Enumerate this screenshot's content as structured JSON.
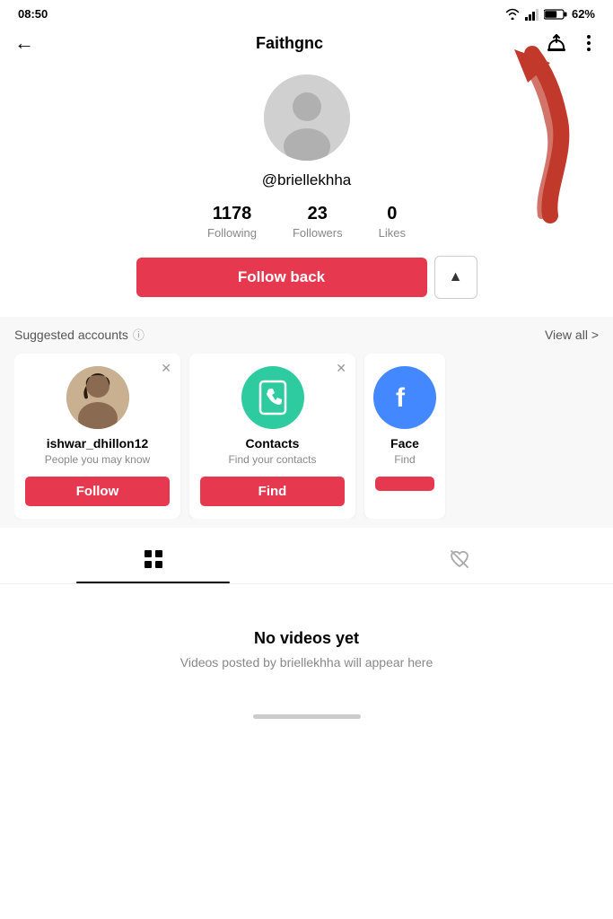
{
  "statusBar": {
    "time": "08:50",
    "battery": "62%"
  },
  "header": {
    "title": "Faithgnc",
    "backLabel": "←",
    "notifyIcon": "notify-icon",
    "moreIcon": "more-icon"
  },
  "profile": {
    "username": "@briellekhha",
    "stats": [
      {
        "value": "1178",
        "label": "Following"
      },
      {
        "value": "23",
        "label": "Followers"
      },
      {
        "value": "0",
        "label": "Likes"
      }
    ],
    "followBackLabel": "Follow back",
    "arrowUpLabel": "▲"
  },
  "suggested": {
    "title": "Suggested accounts",
    "infoIcon": "ⓘ",
    "viewAll": "View all >",
    "accounts": [
      {
        "id": "ishwar_dhillon12",
        "name": "ishwar_dhillon12",
        "desc": "People you may know",
        "btnLabel": "Follow",
        "avatarType": "person"
      },
      {
        "id": "contacts",
        "name": "Contacts",
        "desc": "Find your contacts",
        "btnLabel": "Find",
        "avatarType": "contacts"
      },
      {
        "id": "facebook",
        "name": "Face",
        "desc": "Find",
        "btnLabel": "",
        "avatarType": "face"
      }
    ]
  },
  "tabs": [
    {
      "id": "videos-tab",
      "icon": "grid",
      "active": true
    },
    {
      "id": "liked-tab",
      "icon": "heart",
      "active": false
    }
  ],
  "noVideos": {
    "title": "No videos yet",
    "description": "Videos posted by briellekhha will appear here"
  }
}
